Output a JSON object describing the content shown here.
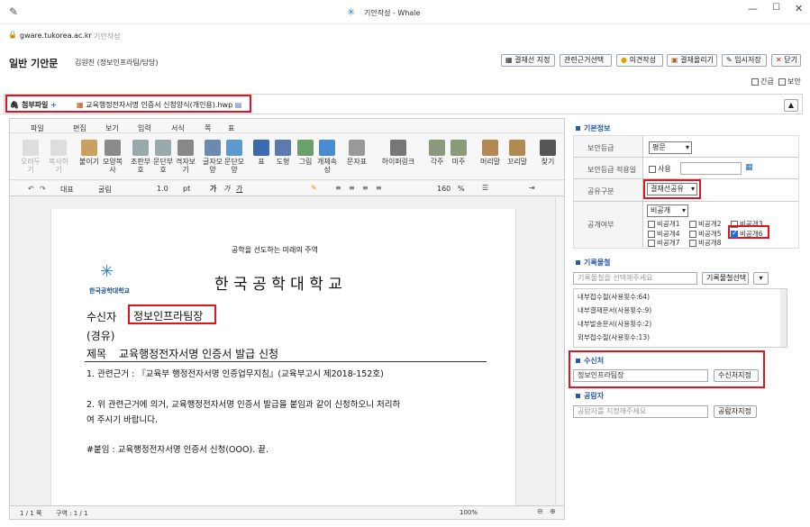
{
  "window": {
    "title": "기안작성 - Whale",
    "url_host": "gware.tukorea.ac.kr",
    "url_page": "기안작성"
  },
  "header": {
    "title": "일반 기안문",
    "author": "김원진 (정보인프라팀/담당)"
  },
  "toolbar_buttons": [
    "결재선 지정",
    "관련근거선택",
    "의견작성",
    "결재올리기",
    "임시저장",
    "닫기"
  ],
  "options": {
    "urgent": "긴급",
    "secure": "보안"
  },
  "attachment": {
    "label": "첨부파일",
    "file": "교육행정전자서명 인증서 신청양식(개인용).hwp"
  },
  "editor": {
    "menus": [
      "파일",
      "편집",
      "보기",
      "입력",
      "서식",
      "쪽",
      "표"
    ],
    "tools": [
      "오려두기",
      "복사하기",
      "붙이기",
      "모양복사",
      "조판부호",
      "문단부호",
      "격자보기",
      "글자모양",
      "문단모양",
      "표",
      "도형",
      "그림",
      "개체속성",
      "문자표",
      "하이퍼링크",
      "각주",
      "미주",
      "머리말",
      "꼬리말",
      "찾기"
    ],
    "style": "대표",
    "font": "굴림",
    "size": "1.0",
    "size_unit": "pt",
    "zoom_pct": "160",
    "pct": "%",
    "status_page": "1 / 1 쪽",
    "status_section": "구역 : 1 / 1",
    "status_zoom": "100%"
  },
  "document": {
    "slogan": "공학을 선도하는 미래의 주역",
    "org": "한 국 공 학 대 학 교",
    "logo_text": "한국공학대학교",
    "recipient_label": "수신자",
    "recipient": "정보인프라팀장",
    "via": "(경유)",
    "subject_label": "제목",
    "subject": "교육행정전자서명 인증서 발급 신청",
    "line1": "1. 관련근거 : 『교육부 행정전자서명 인증업무지침』(교육부고시 제2018-152호)",
    "line2a": "2. 위 관련근거에 의거, 교육행정전자서명 인증서 발급을 붙임과 같이 신청하오니 처리하",
    "line2b": "여 주시기 바랍니다.",
    "attach": "#붙임 : 교육행정전자서명 인증서 신청(OOO).  끝."
  },
  "panel": {
    "basic": "기본정보",
    "sec_grade_label": "보안등급",
    "sec_grade": "평문",
    "sec_apply_label": "보안등급 적용일",
    "sec_apply_use": "사용",
    "share_label": "공유구분",
    "share": "결재선공유",
    "public_label": "공개여부",
    "public": "비공개",
    "private_items": [
      "비공개1",
      "비공개2",
      "비공개3",
      "비공개4",
      "비공개5",
      "비공개6",
      "비공개7",
      "비공개8"
    ],
    "record": "기록물철",
    "record_ph": "기록물철을 선택해주세요",
    "record_btn": "기록물철선택",
    "record_list": [
      "내부접수철(사용횟수:64)",
      "내부결재문서(사용횟수:9)",
      "내부발송문서(사용횟수:2)",
      "외부접수철(사용횟수:13)"
    ],
    "receiver": "수신처",
    "receiver_val": "정보인프라팀장",
    "receiver_btn": "수신처지정",
    "viewer": "공람자",
    "viewer_ph": "공람자를 지정해주세요",
    "viewer_btn": "공람자지정"
  }
}
